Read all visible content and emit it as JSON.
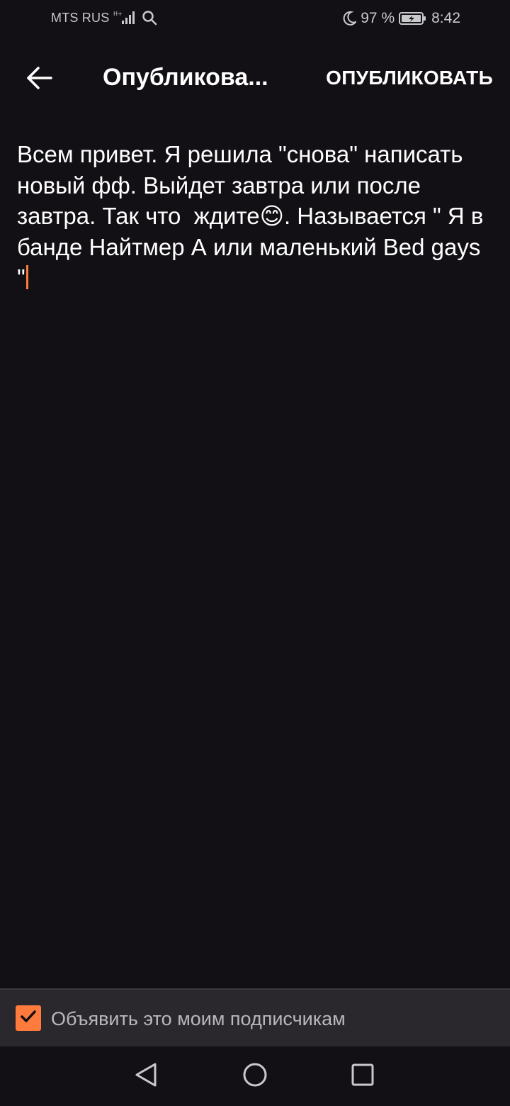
{
  "status_bar": {
    "carrier": "MTS RUS",
    "battery": "97 %",
    "time": "8:42",
    "icons": [
      "signal-icon",
      "search-icon",
      "moon-icon",
      "battery-icon"
    ]
  },
  "app_bar": {
    "title": "Опубликова...",
    "publish_label": "ОПУБЛИКОВАТЬ",
    "back_icon": "arrow-left-icon"
  },
  "editor": {
    "text": "Всем привет. Я решила \"снова\" написать новый фф. Выйдет завтра или после завтра. Так что  ждите😊. Называется \" Я в банде Найтмер А или маленький Bed gays \""
  },
  "announce": {
    "checked": true,
    "label": "Объявить это моим подписчикам"
  },
  "nav_bar": {
    "icons": [
      "back-triangle-icon",
      "home-circle-icon",
      "recents-square-icon"
    ]
  },
  "colors": {
    "background": "#121014",
    "accent": "#ff7a3d",
    "panel": "#2a282c"
  }
}
